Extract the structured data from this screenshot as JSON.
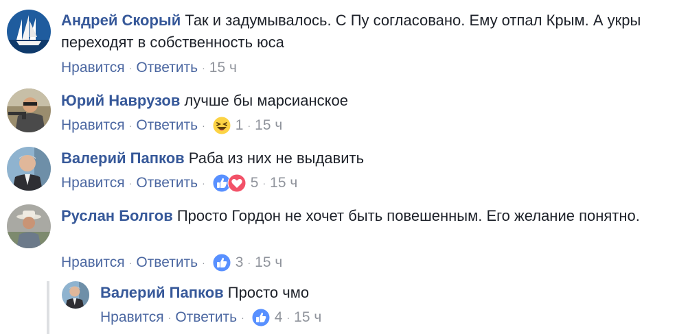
{
  "comments": [
    {
      "author": "Андрей Скорый",
      "text": "Так и задумывалось. С Пу согласовано. Ему отпал Крым. А укры переходят в собственность юса",
      "like_label": "Нравится",
      "reply_label": "Ответить",
      "time": "15 ч",
      "reactions": [],
      "reaction_count": "",
      "avatar": "sailing-ship-avatar"
    },
    {
      "author": "Юрий Наврузов",
      "text": "лучше бы марсианское",
      "like_label": "Нравится",
      "reply_label": "Ответить",
      "time": "15 ч",
      "reactions": [
        "haha-icon"
      ],
      "reaction_count": "1",
      "avatar": "man-with-gun-avatar"
    },
    {
      "author": "Валерий Папков",
      "text": "Раба из них не выдавить",
      "like_label": "Нравится",
      "reply_label": "Ответить",
      "time": "15 ч",
      "reactions": [
        "like-icon",
        "love-icon"
      ],
      "reaction_count": "5",
      "avatar": "man-in-suit-avatar"
    },
    {
      "author": "Руслан Болгов",
      "text": "Просто Гордон не хочет быть повешенным. Его желание понятно.",
      "like_label": "Нравится",
      "reply_label": "Ответить",
      "time": "15 ч",
      "reactions": [
        "like-icon"
      ],
      "reaction_count": "3",
      "avatar": "man-in-hat-avatar"
    }
  ],
  "reply": {
    "author": "Валерий Папков",
    "text": "Просто чмо",
    "like_label": "Нравится",
    "reply_label": "Ответить",
    "time": "15 ч",
    "reactions": [
      "like-icon"
    ],
    "reaction_count": "4",
    "avatar": "man-in-suit-avatar"
  },
  "colors": {
    "author": "#365899",
    "action_link": "#4b67a1",
    "meta": "#90949c",
    "like": "#5890ff",
    "love": "#f25268",
    "haha": "#fcd344"
  }
}
